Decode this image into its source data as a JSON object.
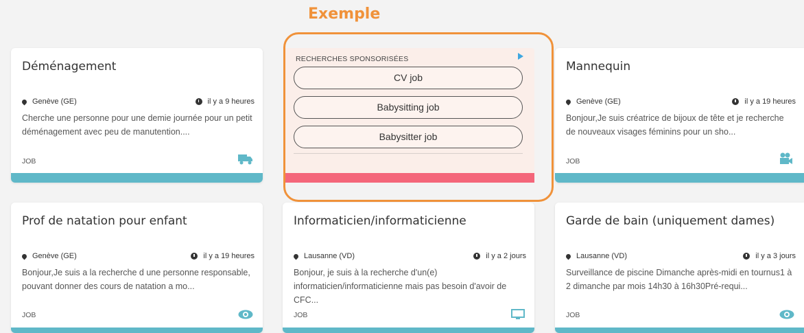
{
  "header": {
    "label": "Exemple"
  },
  "sponsored": {
    "label": "RECHERCHES SPONSORISÉES",
    "buttons": [
      "CV job",
      "Babysitting job",
      "Babysitter job"
    ]
  },
  "cards": [
    {
      "title": "Déménagement",
      "location": "Genève (GE)",
      "time": "il y a 9 heures",
      "description": "Cherche une personne pour une demie journée pour un petit déménagement avec peu de manutention....",
      "tag": "JOB",
      "icon": "truck-icon"
    },
    {
      "title": "Mannequin",
      "location": "Genève (GE)",
      "time": "il y a 19 heures",
      "description": "Bonjour,Je suis créatrice de bijoux de tête et je recherche de nouveaux visages féminins pour un sho...",
      "tag": "JOB",
      "icon": "video-camera-icon"
    },
    {
      "title": "Prof de natation pour enfant",
      "location": "Genève (GE)",
      "time": "il y a 19 heures",
      "description": "Bonjour,Je suis a la recherche d une personne responsable, pouvant donner des cours de natation a mo...",
      "tag": "JOB",
      "icon": "eye-icon"
    },
    {
      "title": "Informaticien/informaticienne",
      "location": "Lausanne (VD)",
      "time": "il y a 2 jours",
      "description": "Bonjour, je suis à la recherche d'un(e) informaticien/informaticienne mais pas besoin d'avoir de CFC...",
      "tag": "JOB",
      "icon": "monitor-icon"
    },
    {
      "title": "Garde de bain (uniquement dames)",
      "location": "Lausanne (VD)",
      "time": "il y a 3 jours",
      "description": "Surveillance de piscine Dimanche après-midi en tournus1 à 2 dimanche par mois 14h30 à 16h30Pré-requi...",
      "tag": "JOB",
      "icon": "eye-icon"
    }
  ],
  "colors": {
    "accent": "#f0923a",
    "teal": "#5fb8c8",
    "pink": "#f4667a"
  }
}
